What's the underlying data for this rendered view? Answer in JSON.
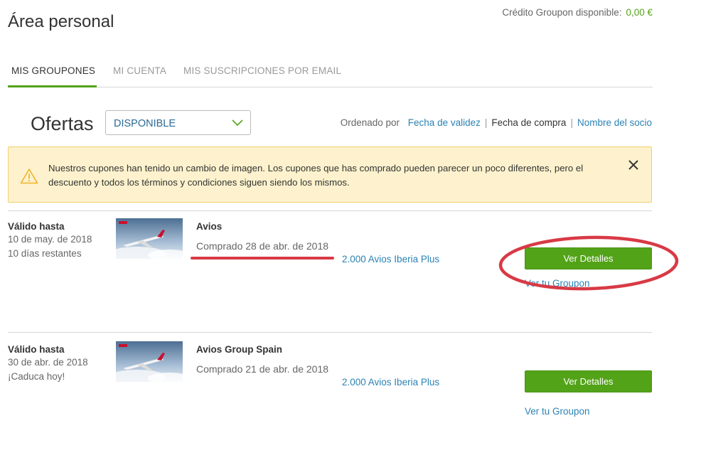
{
  "header": {
    "title": "Área personal",
    "credit_label": "Crédito Groupon disponible:",
    "credit_amount": "0,00 €"
  },
  "tabs": [
    {
      "label": "MIS GROUPONES",
      "active": true
    },
    {
      "label": "MI CUENTA",
      "active": false
    },
    {
      "label": "MIS SUSCRIPCIONES POR EMAIL",
      "active": false
    }
  ],
  "filter": {
    "title": "Ofertas",
    "selected": "DISPONIBLE",
    "sort_label": "Ordenado por",
    "sort_options": [
      "Fecha de validez",
      "Fecha de compra",
      "Nombre del socio"
    ],
    "sort_selected": "Fecha de compra"
  },
  "alert": {
    "icon": "warning-icon",
    "text": "Nuestros cupones han tenido un cambio de imagen. Los cupones que has comprado pueden parecer un poco diferentes, pero el descuento y todos los términos y condiciones siguen siendo los mismos."
  },
  "deals": [
    {
      "valid_label": "Válido hasta",
      "valid_date": "10 de may. de 2018",
      "remaining": "10 días restantes",
      "title": "Avios",
      "purchased": "Comprado 28 de abr. de 2018",
      "option": "2.000 Avios Iberia Plus",
      "button": "Ver Detalles",
      "voucher_link": "Ver tu Groupon"
    },
    {
      "valid_label": "Válido hasta",
      "valid_date": "30 de abr. de 2018",
      "remaining": "¡Caduca hoy!",
      "title": "Avios Group Spain",
      "purchased": "Comprado 21 de abr. de 2018",
      "option": "2.000 Avios Iberia Plus",
      "button": "Ver Detalles",
      "voucher_link": "Ver tu Groupon"
    }
  ],
  "colors": {
    "accent_green": "#53a318",
    "link_blue": "#2b82b4",
    "alert_bg": "#fdf2cd",
    "annotation_red": "#d83a45"
  }
}
